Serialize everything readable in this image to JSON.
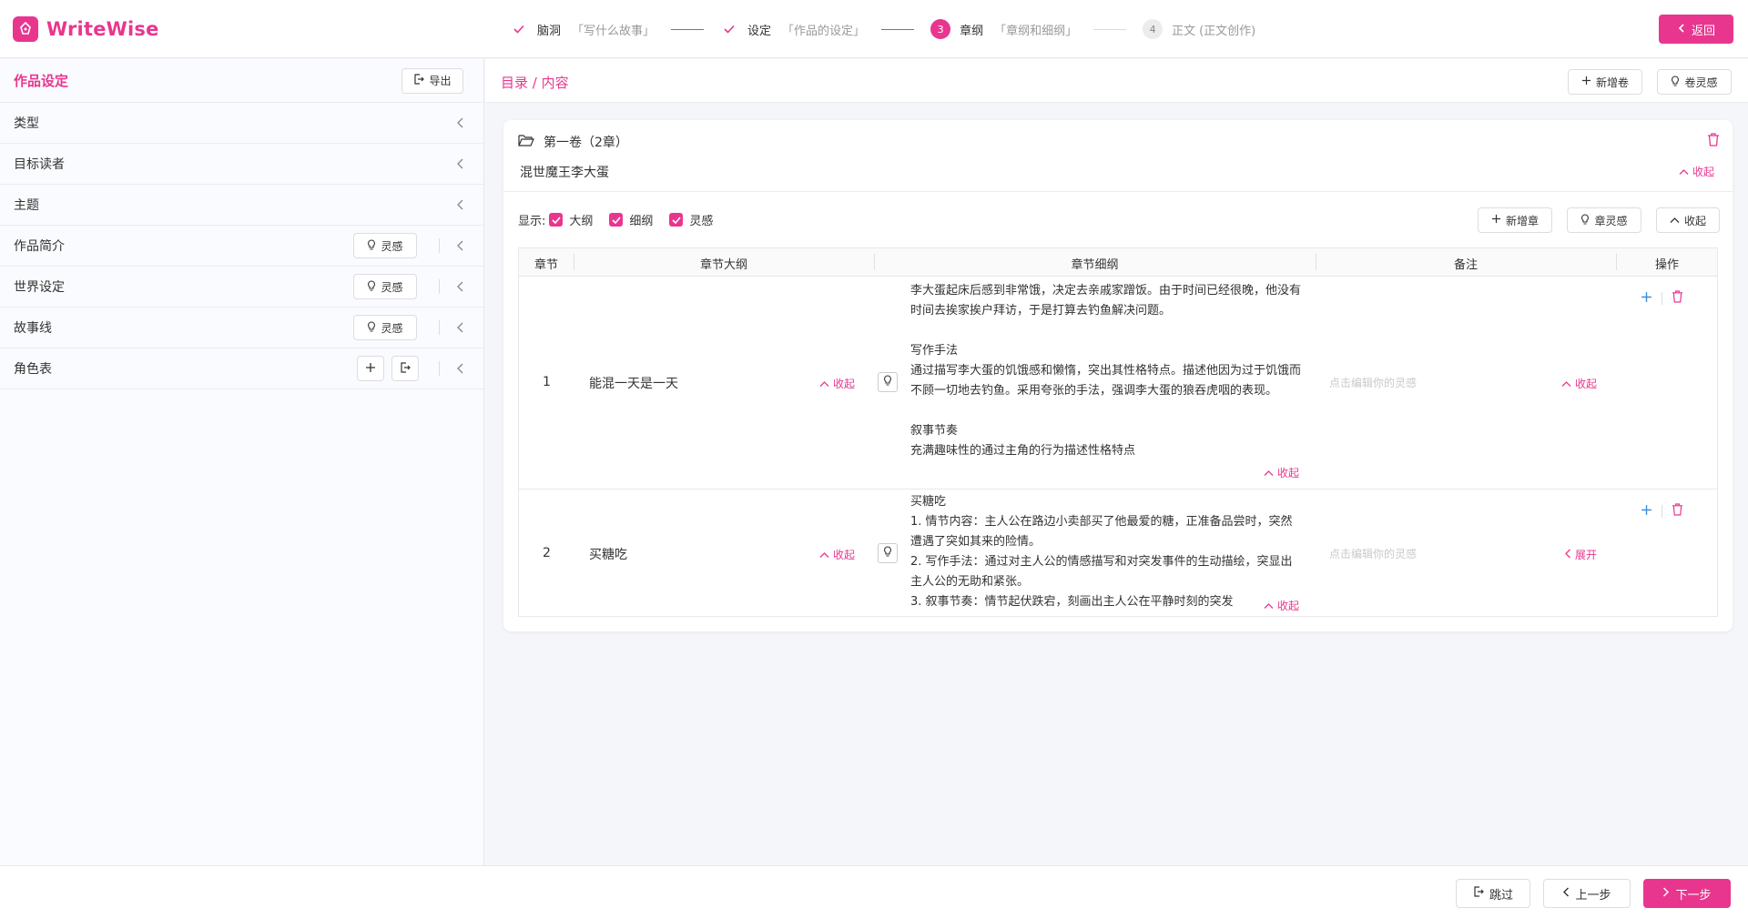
{
  "app": {
    "name": "WriteWise",
    "accent": "#e8368f"
  },
  "steps": [
    {
      "label": "脑洞",
      "desc": "「写什么故事」",
      "state": "done"
    },
    {
      "label": "设定",
      "desc": "「作品的设定」",
      "state": "done"
    },
    {
      "num": "3",
      "label": "章纲",
      "desc": "「章纲和细纲」",
      "state": "active"
    },
    {
      "num": "4",
      "label": "正文",
      "desc": "(正文创作)",
      "state": "pending"
    }
  ],
  "header": {
    "back_label": "返回"
  },
  "sidebar": {
    "title": "作品设定",
    "export_label": "导出",
    "items": [
      {
        "label": "类型"
      },
      {
        "label": "目标读者"
      },
      {
        "label": "主题"
      },
      {
        "label": "作品简介",
        "action": "灵感"
      },
      {
        "label": "世界设定",
        "action": "灵感"
      },
      {
        "label": "故事线",
        "action": "灵感"
      },
      {
        "label": "角色表"
      }
    ]
  },
  "main": {
    "breadcrumb": "目录 / 内容",
    "add_volume": "新增卷",
    "volume_inspiration": "卷灵感"
  },
  "volume": {
    "title": "第一卷（2章）",
    "subtitle": "混世魔王李大蛋",
    "collapse": "收起",
    "show_label": "显示:",
    "filters": [
      "大纲",
      "细纲",
      "灵感"
    ],
    "add_chapter": "新增章",
    "chapter_inspiration": "章灵感",
    "collapse_btn": "收起",
    "columns": [
      "章节",
      "章节大纲",
      "章节细纲",
      "备注",
      "操作"
    ],
    "note_placeholder": "点击编辑你的灵感",
    "rows": [
      {
        "num": "1",
        "outline": "能混一天是一天",
        "outline_toggle": "收起",
        "detail": "李大蛋起床后感到非常饿，决定去亲戚家蹭饭。由于时间已经很晚，他没有时间去挨家挨户拜访，于是打算去钓鱼解决问题。\n\n写作手法\n通过描写李大蛋的饥饿感和懒惰，突出其性格特点。描述他因为过于饥饿而不顾一切地去钓鱼。采用夸张的手法，强调李大蛋的狼吞虎咽的表现。\n\n叙事节奏\n充满趣味性的通过主角的行为描述性格特点",
        "detail_toggle": "收起",
        "note_toggle": "收起"
      },
      {
        "num": "2",
        "outline": "买糖吃",
        "outline_toggle": "收起",
        "detail": "买糖吃\n1. 情节内容：主人公在路边小卖部买了他最爱的糖，正准备品尝时，突然遭遇了突如其来的险情。\n2. 写作手法：通过对主人公的情感描写和对突发事件的生动描绘，突显出主人公的无助和紧张。\n3. 叙事节奏：情节起伏跌宕，刻画出主人公在平静时刻的突发",
        "detail_toggle": "收起",
        "note_toggle": "展开"
      }
    ]
  },
  "footer": {
    "skip": "跳过",
    "prev": "上一步",
    "next": "下一步"
  }
}
